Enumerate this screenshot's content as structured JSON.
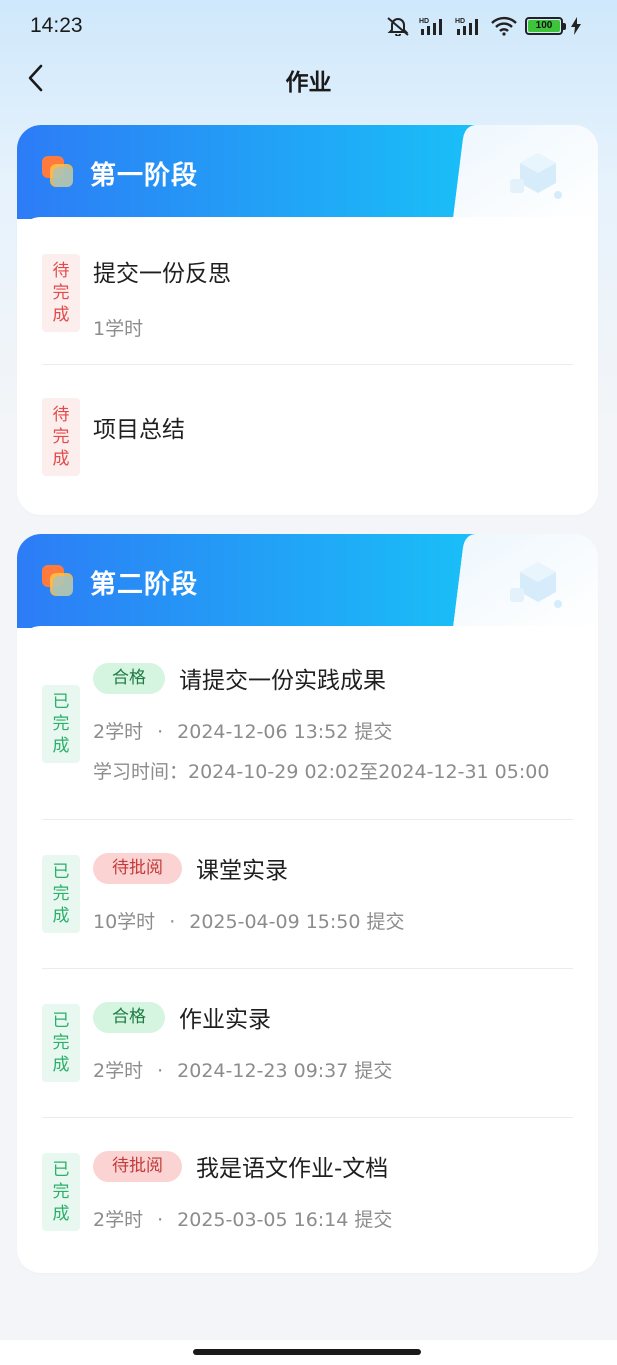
{
  "status_bar": {
    "time": "14:23",
    "icons": [
      "mute-bell-icon",
      "hd-signal-icon",
      "hd-signal-icon",
      "wifi-icon",
      "battery-icon",
      "charging-icon"
    ],
    "battery_level": "100"
  },
  "header": {
    "title": "作业",
    "back_icon": "chevron-left-icon"
  },
  "colors": {
    "stage_gradient_start": "#2d7cf6",
    "stage_gradient_end": "#19c0f7",
    "pending_text": "#e24a4a",
    "pending_bg": "#fdeeee",
    "done_text": "#2bb06a",
    "done_bg": "#e8f8f0",
    "pass_pill_bg": "#d5f5e0",
    "review_pill_bg": "#fbd3d3"
  },
  "stages": [
    {
      "title": "第一阶段",
      "items": [
        {
          "status": "待完成",
          "title": "提交一份反思",
          "hours": "1学时"
        },
        {
          "status": "待完成",
          "title": "项目总结"
        }
      ]
    },
    {
      "title": "第二阶段",
      "items": [
        {
          "status": "已完成",
          "result": "合格",
          "title": "请提交一份实践成果",
          "hours": "2学时",
          "sep": "·",
          "submitted": "2024-12-06 13:52 提交",
          "study_time": "学习时间：2024-10-29 02:02至2024-12-31 05:00"
        },
        {
          "status": "已完成",
          "result": "待批阅",
          "title": "课堂实录",
          "hours": "10学时",
          "sep": "·",
          "submitted": "2025-04-09 15:50 提交"
        },
        {
          "status": "已完成",
          "result": "合格",
          "title": "作业实录",
          "hours": "2学时",
          "sep": "·",
          "submitted": "2024-12-23 09:37 提交"
        },
        {
          "status": "已完成",
          "result": "待批阅",
          "title": "我是语文作业-文档",
          "hours": "2学时",
          "sep": "·",
          "submitted": "2025-03-05 16:14 提交"
        }
      ]
    }
  ]
}
